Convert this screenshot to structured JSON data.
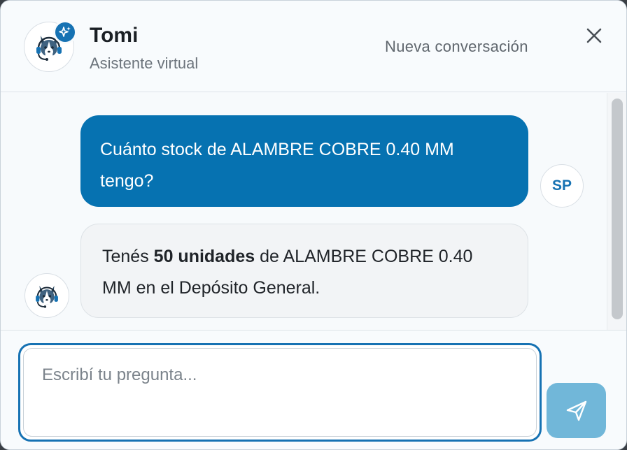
{
  "header": {
    "title": "Tomi",
    "subtitle": "Asistente virtual",
    "new_conversation_label": "Nueva conversación",
    "avatar_icon": "husky-headset-icon",
    "badge_icon": "sparkles-icon",
    "close_icon": "close-icon"
  },
  "messages": {
    "user": {
      "text": "Cuánto stock de ALAMBRE COBRE 0.40 MM tengo?",
      "avatar_initials": "SP"
    },
    "bot": {
      "text_before": "Tenés ",
      "text_bold": "50 unidades",
      "text_after": " de ALAMBRE COBRE 0.40 MM en el Depósito General."
    }
  },
  "composer": {
    "placeholder": "Escribí tu pregunta...",
    "value": "",
    "send_icon": "send-icon"
  },
  "colors": {
    "accent": "#0672b1",
    "send_button": "#71b7d9",
    "bot_bubble": "#f2f4f6"
  }
}
